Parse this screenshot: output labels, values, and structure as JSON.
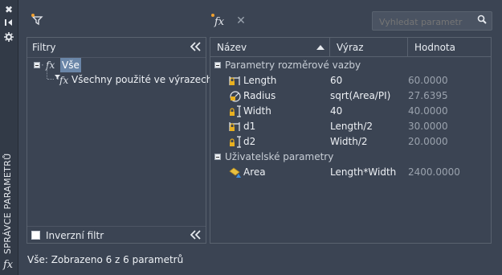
{
  "sidebar": {
    "title": "SPRÁVCE PARAMETRŮ",
    "icons": [
      "close-icon",
      "pin-icon",
      "settings-icon",
      "fx-icon"
    ]
  },
  "toolbar": {
    "new_filter_icon": "funnel-star-icon",
    "new_parameter_icon": "fx-star-icon",
    "delete_icon": "delete-x-icon",
    "search_placeholder": "Vyhledat parametr",
    "search_icon": "search-icon"
  },
  "filters": {
    "header": "Filtry",
    "items": [
      {
        "label": "Vše",
        "selected": true
      },
      {
        "label": "Všechny použité ve výrazech",
        "selected": false
      }
    ],
    "inverse_filter_label": "Inverzní filtr",
    "inverse_filter_checked": false
  },
  "grid": {
    "columns": [
      "Název",
      "Výraz",
      "Hodnota"
    ],
    "sorted_column": "Název",
    "groups": [
      {
        "label": "Parametry rozměrové vazby",
        "rows": [
          {
            "icon": "linear-dimension-icon",
            "name": "Length",
            "expression": "60",
            "value": "60.0000"
          },
          {
            "icon": "radius-dimension-icon",
            "name": "Radius",
            "expression": "sqrt(Area/PI)",
            "value": "27.6395"
          },
          {
            "icon": "vertical-dimension-icon",
            "name": "Width",
            "expression": "40",
            "value": "40.0000"
          },
          {
            "icon": "linear-dimension-icon",
            "name": "d1",
            "expression": "Length/2",
            "value": "30.0000"
          },
          {
            "icon": "vertical-dimension-icon",
            "name": "d2",
            "expression": "Width/2",
            "value": "20.0000"
          }
        ]
      },
      {
        "label": "Uživatelské parametry",
        "rows": [
          {
            "icon": "user-parameter-icon",
            "name": "Area",
            "expression": "Length*Width",
            "value": "2400.0000"
          }
        ]
      }
    ]
  },
  "status": "Vše: Zobrazeno 6 z 6 parametrů",
  "colors": {
    "background": "#3b4453",
    "selection": "#6a86a8",
    "text": "#e8ecf1",
    "muted_value": "#9aa2ad"
  }
}
